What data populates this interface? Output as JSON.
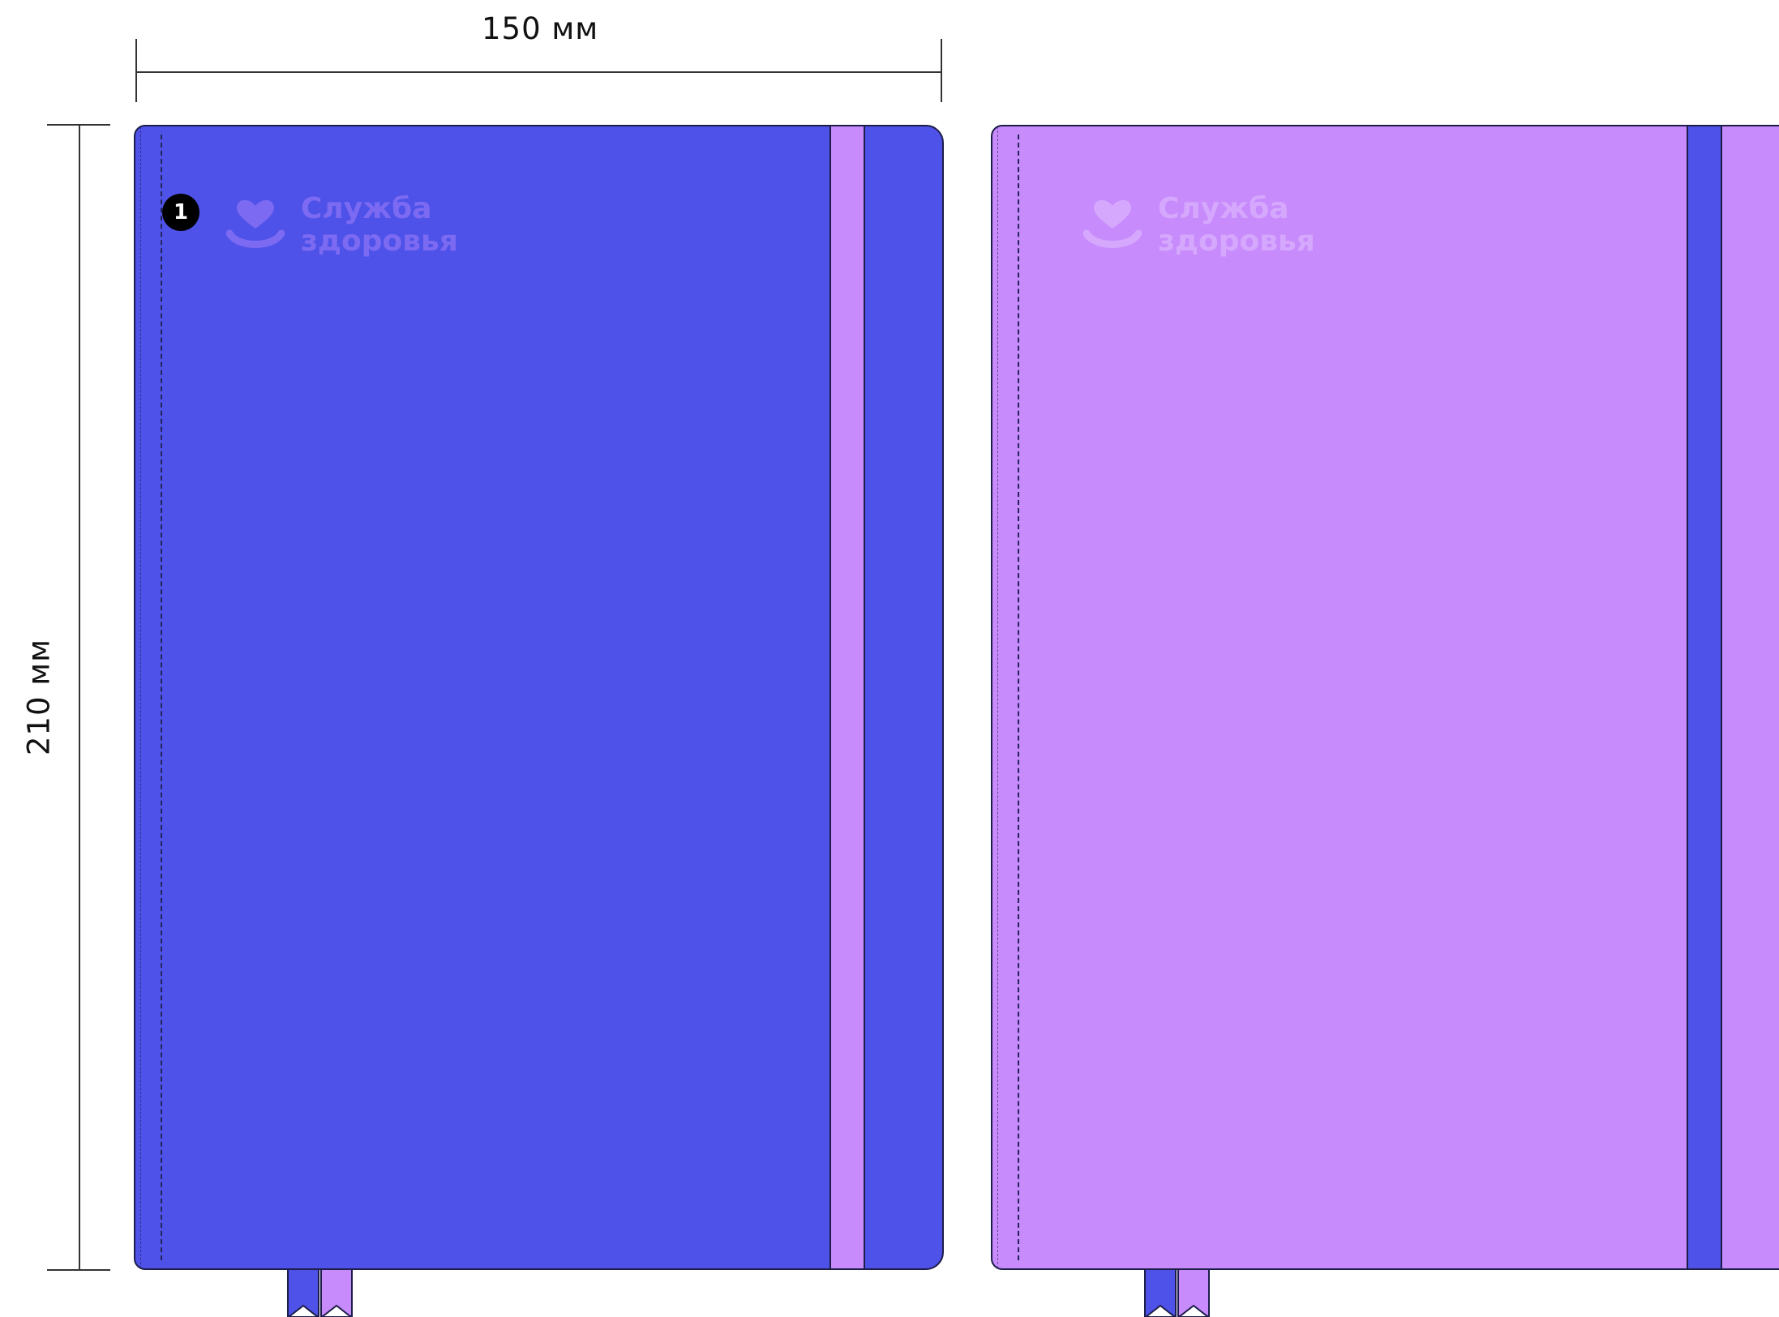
{
  "dimensions": {
    "width_label": "150 мм",
    "height_label": "210 мм"
  },
  "colors": {
    "blue": "#4F52E8",
    "lilac": "#C78BFC",
    "outline": "#1d1d4a",
    "logo_on_blue": "#7C6BF2",
    "logo_on_lilac": "#D6A8FD"
  },
  "marker": {
    "number": "1"
  },
  "notebooks": [
    {
      "cover_color": "blue",
      "band_color": "lilac",
      "logo": {
        "line1": "Служба",
        "line2": "здоровья",
        "icon": "heart-smile-icon"
      }
    },
    {
      "cover_color": "lilac",
      "band_color": "blue",
      "logo": {
        "line1": "Служба",
        "line2": "здоровья",
        "icon": "heart-smile-icon"
      }
    }
  ]
}
